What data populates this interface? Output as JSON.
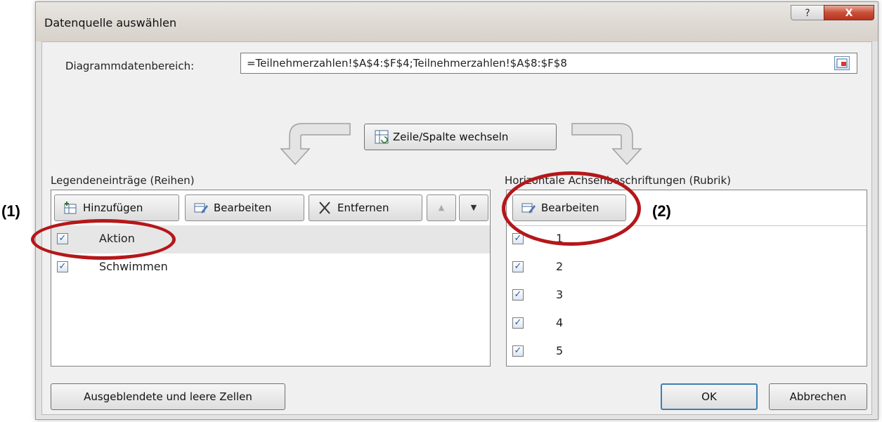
{
  "dialog": {
    "title": "Datenquelle auswählen",
    "help_label": "?",
    "close_label": "X"
  },
  "range": {
    "label": "Diagrammdatenbereich:",
    "value": "=Teilnehmerzahlen!$A$4:$F$4;Teilnehmerzahlen!$A$8:$F$8"
  },
  "switch_button": {
    "label": "Zeile/Spalte wechseln"
  },
  "legend": {
    "header": "Legendeneinträge (Reihen)",
    "buttons": {
      "add": "Hinzufügen",
      "edit": "Bearbeiten",
      "remove": "Entfernen",
      "up": "▲",
      "down": "▼"
    },
    "items": [
      {
        "label": "Aktion",
        "checked": true,
        "selected": true
      },
      {
        "label": "Schwimmen",
        "checked": true,
        "selected": false
      }
    ]
  },
  "axis": {
    "header": "Horizontale Achsenbeschriftungen (Rubrik)",
    "edit_label": "Bearbeiten",
    "items": [
      {
        "label": "1",
        "checked": true
      },
      {
        "label": "2",
        "checked": true
      },
      {
        "label": "3",
        "checked": true
      },
      {
        "label": "4",
        "checked": true
      },
      {
        "label": "5",
        "checked": true
      }
    ]
  },
  "footer": {
    "hidden_cells": "Ausgeblendete und leere Zellen",
    "ok": "OK",
    "cancel": "Abbrechen"
  },
  "annotations": {
    "one": "(1)",
    "two": "(2)"
  },
  "colors": {
    "annotation_ring": "#b5171a",
    "check": "#2b5ea6",
    "ok_border": "#3c7fb1"
  },
  "checkmark": "✓"
}
